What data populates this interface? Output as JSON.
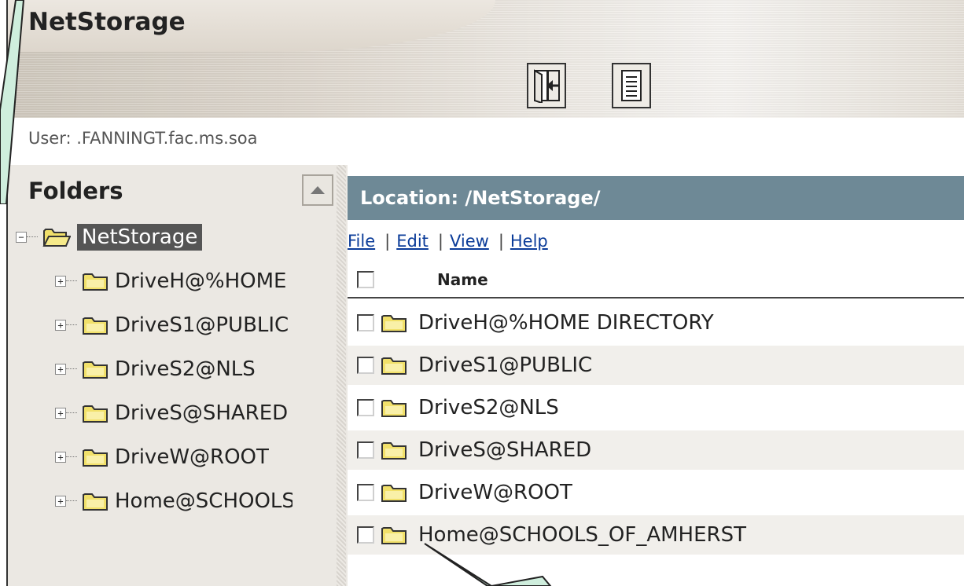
{
  "app": {
    "title": "NetStorage"
  },
  "user": {
    "label": "User: .FANNINGT.fac.ms.soa"
  },
  "toolbar": {
    "buttons": [
      {
        "icon": "exit-door-icon"
      },
      {
        "icon": "document-icon"
      }
    ]
  },
  "sidebar": {
    "title": "Folders",
    "root": {
      "label": "NetStorage",
      "expander": "−"
    },
    "items": [
      {
        "label": "DriveH@%HOME DIRECTORY",
        "expander": "+"
      },
      {
        "label": "DriveS1@PUBLIC",
        "expander": "+"
      },
      {
        "label": "DriveS2@NLS",
        "expander": "+"
      },
      {
        "label": "DriveS@SHARED",
        "expander": "+"
      },
      {
        "label": "DriveW@ROOT",
        "expander": "+"
      },
      {
        "label": "Home@SCHOOLS_OF_AMHERST",
        "expander": "+"
      }
    ]
  },
  "main": {
    "location": "Location: /NetStorage/",
    "menu": [
      {
        "label": "File"
      },
      {
        "label": "Edit"
      },
      {
        "label": "View"
      },
      {
        "label": "Help"
      }
    ],
    "menu_separator": "|",
    "columns": {
      "name": "Name"
    },
    "files": [
      {
        "name": "DriveH@%HOME DIRECTORY"
      },
      {
        "name": "DriveS1@PUBLIC"
      },
      {
        "name": "DriveS2@NLS"
      },
      {
        "name": "DriveS@SHARED"
      },
      {
        "name": "DriveW@ROOT"
      },
      {
        "name": "Home@SCHOOLS_OF_AMHERST"
      }
    ]
  },
  "colors": {
    "location_bar": "#6e8996",
    "folder_fill": "#f1e06a",
    "selected_bg": "#555555",
    "link": "#0b3c99"
  }
}
